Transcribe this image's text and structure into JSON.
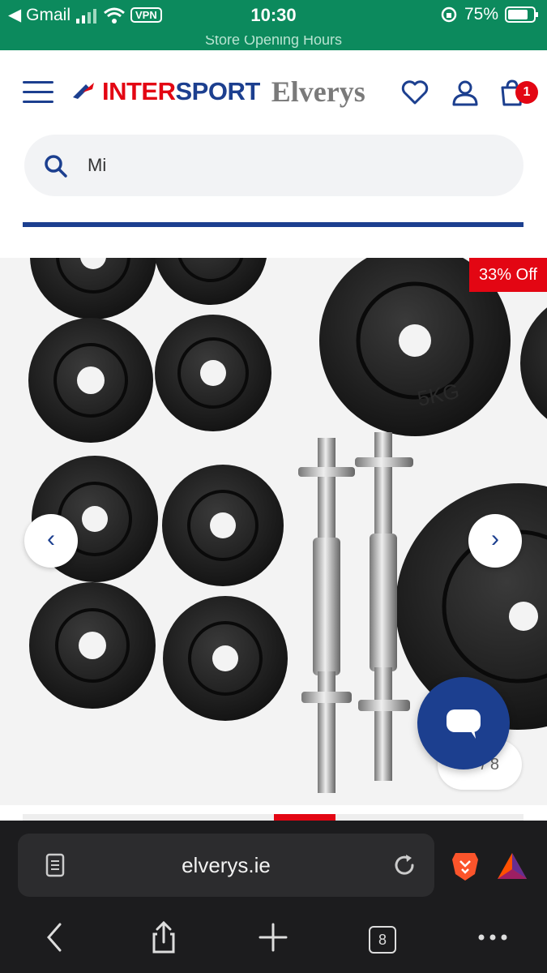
{
  "status_bar": {
    "back_app": "Gmail",
    "vpn": "VPN",
    "time": "10:30",
    "battery": "75%",
    "peek_text": "Store Opening Hours"
  },
  "header": {
    "logo_text_red": "INTER",
    "logo_text_blue": "SPORT",
    "logo_elverys": "Elverys",
    "cart_count": "1"
  },
  "search": {
    "value": "Mi"
  },
  "gallery": {
    "discount_badge": "33% Off",
    "prev_glyph": "‹",
    "next_glyph": "›",
    "counter_text": "/ 8"
  },
  "browser": {
    "url": "elverys.ie",
    "tab_count": "8"
  },
  "colors": {
    "status_green": "#0c8a5d",
    "brand_blue": "#1c3f8f",
    "brand_red": "#e30613",
    "browser_dark": "#1c1c1e"
  }
}
